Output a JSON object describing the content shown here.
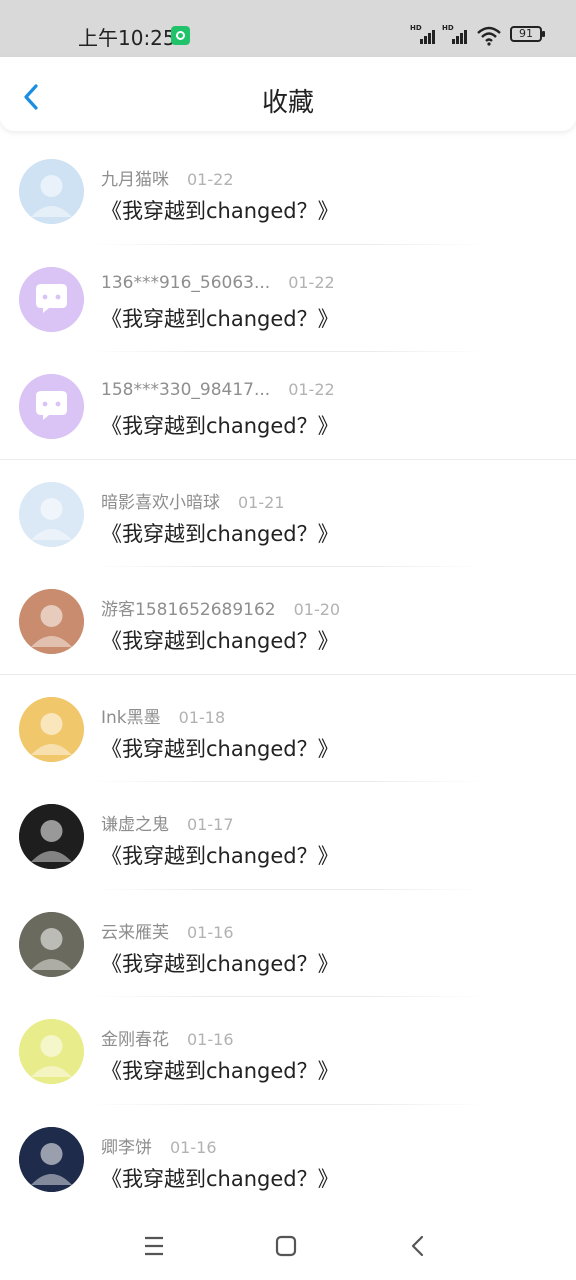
{
  "status_bar": {
    "time": "上午10:25",
    "app_badge_icon": "shield-app-icon",
    "signal_1_label": "HD",
    "signal_2_label": "HD",
    "wifi_icon": "wifi-icon",
    "battery": "91"
  },
  "header": {
    "back_icon": "chevron-left-icon",
    "title": "收藏"
  },
  "items": [
    {
      "name": "九月猫咪",
      "date": "01-22",
      "title": "《我穿越到changed？》",
      "avatar": "avatar-cartoon-cat",
      "avatar_color": "#cfe2f3"
    },
    {
      "name": "136***916_56063...",
      "date": "01-22",
      "title": "《我穿越到changed？》",
      "avatar": "avatar-default-chat",
      "avatar_color": "#d9c4f5"
    },
    {
      "name": "158***330_98417...",
      "date": "01-22",
      "title": "《我穿越到changed？》",
      "avatar": "avatar-default-chat",
      "avatar_color": "#d9c4f5"
    },
    {
      "name": "暗影喜欢小暗球",
      "date": "01-21",
      "title": "《我穿越到changed？》",
      "avatar": "avatar-cartoon-character",
      "avatar_color": "#dbe8f5"
    },
    {
      "name": "游客1581652689162",
      "date": "01-20",
      "title": "《我穿越到changed？》",
      "avatar": "avatar-baby-photo",
      "avatar_color": "#c98c6e"
    },
    {
      "name": "Ink黑墨",
      "date": "01-18",
      "title": "《我穿越到changed？》",
      "avatar": "avatar-colorful-skeleton",
      "avatar_color": "#f1c76b"
    },
    {
      "name": "谦虚之鬼",
      "date": "01-17",
      "title": "《我穿越到changed？》",
      "avatar": "avatar-dark-skeleton",
      "avatar_color": "#1e1e1e"
    },
    {
      "name": "云来雁芙",
      "date": "01-16",
      "title": "《我穿越到changed？》",
      "avatar": "avatar-clocks",
      "avatar_color": "#6a6a5e"
    },
    {
      "name": "金刚春花",
      "date": "01-16",
      "title": "《我穿越到changed？》",
      "avatar": "avatar-anime-girl",
      "avatar_color": "#e9ec8a"
    },
    {
      "name": "卿李饼",
      "date": "01-16",
      "title": "《我穿越到changed？》",
      "avatar": "avatar-dark-skeleton-blue",
      "avatar_color": "#1e2b4a"
    }
  ],
  "bottom_nav": {
    "menu_icon": "menu-icon",
    "home_icon": "home-square-icon",
    "back_icon": "back-triangle-icon"
  }
}
